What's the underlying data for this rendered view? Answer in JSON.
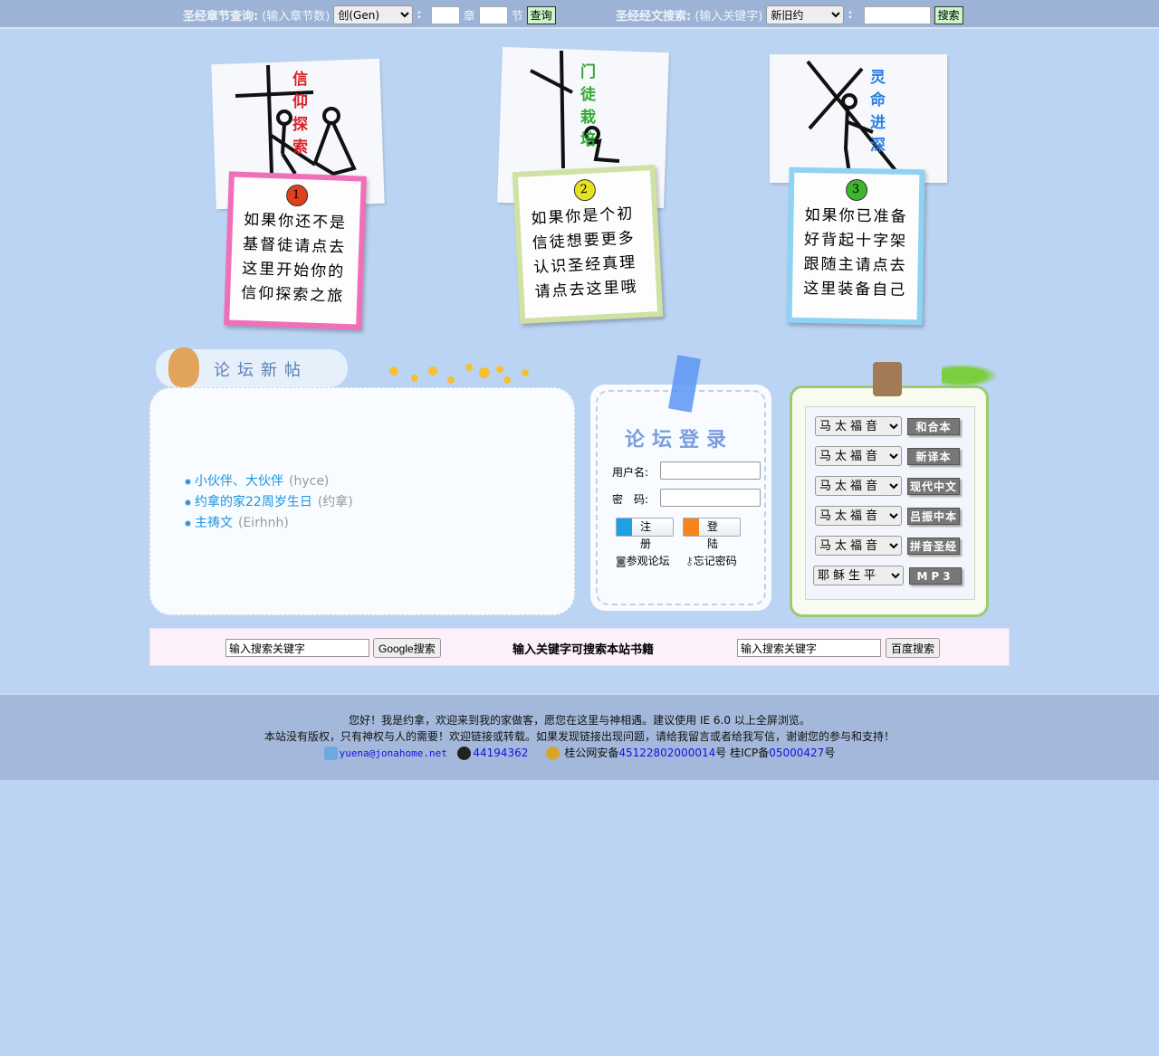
{
  "topbar": {
    "chapter_label": "圣经章节查询:",
    "chapter_hint": "(输入章节数)",
    "book_selected": "创(Gen)",
    "colon": ":",
    "chapter_unit": "章",
    "verse_unit": "节",
    "query_button": "查询",
    "search_label": "圣经经文搜索:",
    "search_hint": "(输入关键字)",
    "testament_selected": "新旧约",
    "search_button": "搜索"
  },
  "cards": [
    {
      "title": "信仰探索",
      "number": "1",
      "lines": [
        "如果你还不是",
        "基督徒请点去",
        "这里开始你的",
        "信仰探索之旅"
      ],
      "title_color": "#d8232a",
      "note_color": "#f06fb8"
    },
    {
      "title": "门徒栽培",
      "number": "2",
      "lines": [
        "如果你是个初",
        "信徒想要更多",
        "认识圣经真理",
        "请点去这里哦"
      ],
      "title_color": "#33a834",
      "note_color": "#cfe2a4"
    },
    {
      "title": "灵命进深",
      "number": "3",
      "lines": [
        "如果你已准备",
        "好背起十字架",
        "跟随主请点去",
        "这里装备自己"
      ],
      "title_color": "#2a7fe0",
      "note_color": "#8fd3f2"
    }
  ],
  "forum": {
    "title": "论坛新帖",
    "posts": [
      {
        "title": "小伙伴、大伙伴",
        "author": "(hyce)"
      },
      {
        "title": "约拿的家22周岁生日",
        "author": "(约拿)"
      },
      {
        "title": "主祷文",
        "author": "(Eirhnh)"
      }
    ]
  },
  "login": {
    "title": "论坛登录",
    "username_label": "用户名:",
    "password_label": "密　码:",
    "register_button": "注 册",
    "login_button": "登 陆",
    "visit_link": "参观论坛",
    "forgot_link": "忘记密码"
  },
  "bible": {
    "rows": [
      {
        "book": "马太福音",
        "version": "和合本"
      },
      {
        "book": "马太福音",
        "version": "新译本"
      },
      {
        "book": "马太福音",
        "version": "现代中文"
      },
      {
        "book": "马太福音",
        "version": "吕振中本"
      },
      {
        "book": "马太福音",
        "version": "拼音圣经"
      },
      {
        "book": "耶稣生平",
        "version": "MP3"
      }
    ]
  },
  "search": {
    "google_placeholder": "输入搜索关键字",
    "google_button": "Google搜索",
    "middle_text": "输入关键字可搜索本站书籍",
    "baidu_placeholder": "输入搜索关键字",
    "baidu_button": "百度搜索"
  },
  "footer": {
    "line1": "您好！我是约拿，欢迎来到我的家做客，愿您在这里与神相遇。建议使用 IE 6.0 以上全屏浏览。",
    "line2": "本站没有版权，只有神权与人的需要！欢迎链接或转载。如果发现链接出现问题，请给我留言或者给我写信，谢谢您的参与和支持！",
    "email": "yuena@jonahome.net",
    "qq": "44194362",
    "police_prefix": "桂公网安备",
    "police_no": "45122802000014",
    "hao1": "号",
    "icp_prefix": "桂ICP备",
    "icp_no": "05000427",
    "hao2": "号"
  }
}
